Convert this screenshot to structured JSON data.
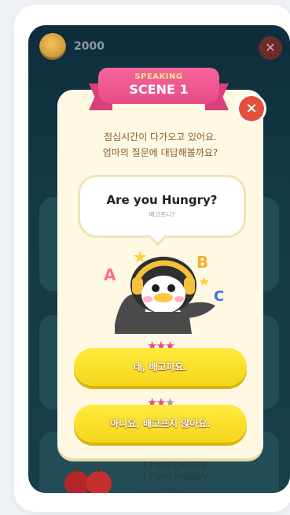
{
  "coin": {
    "count": "2000"
  },
  "modal": {
    "kicker": "SPEAKING",
    "title": "SCENE 1",
    "close_symbol": "×",
    "instruction_line1": "점심시간이 다가오고 있어요.",
    "instruction_line2": "엄마의 질문에 대답해볼까요?",
    "question_en": "Are you Hungry?",
    "question_ko": "배고프니?",
    "answers": [
      {
        "label": "네, 배고파요.",
        "stars_filled": 3,
        "stars_total": 3
      },
      {
        "label": "아니요, 배고프지 않아요.",
        "stars_filled": 2,
        "stars_total": 3
      }
    ]
  },
  "background_list": {
    "item_title_1": "I Feel Happy",
    "item_title_2": "I Feel Happy",
    "item_sub": "나는 행복해"
  },
  "colors": {
    "accent_pink": "#e84c86",
    "button_yellow": "#f6d61c",
    "close_red": "#e44f3b",
    "bg_dark": "#143a47"
  }
}
